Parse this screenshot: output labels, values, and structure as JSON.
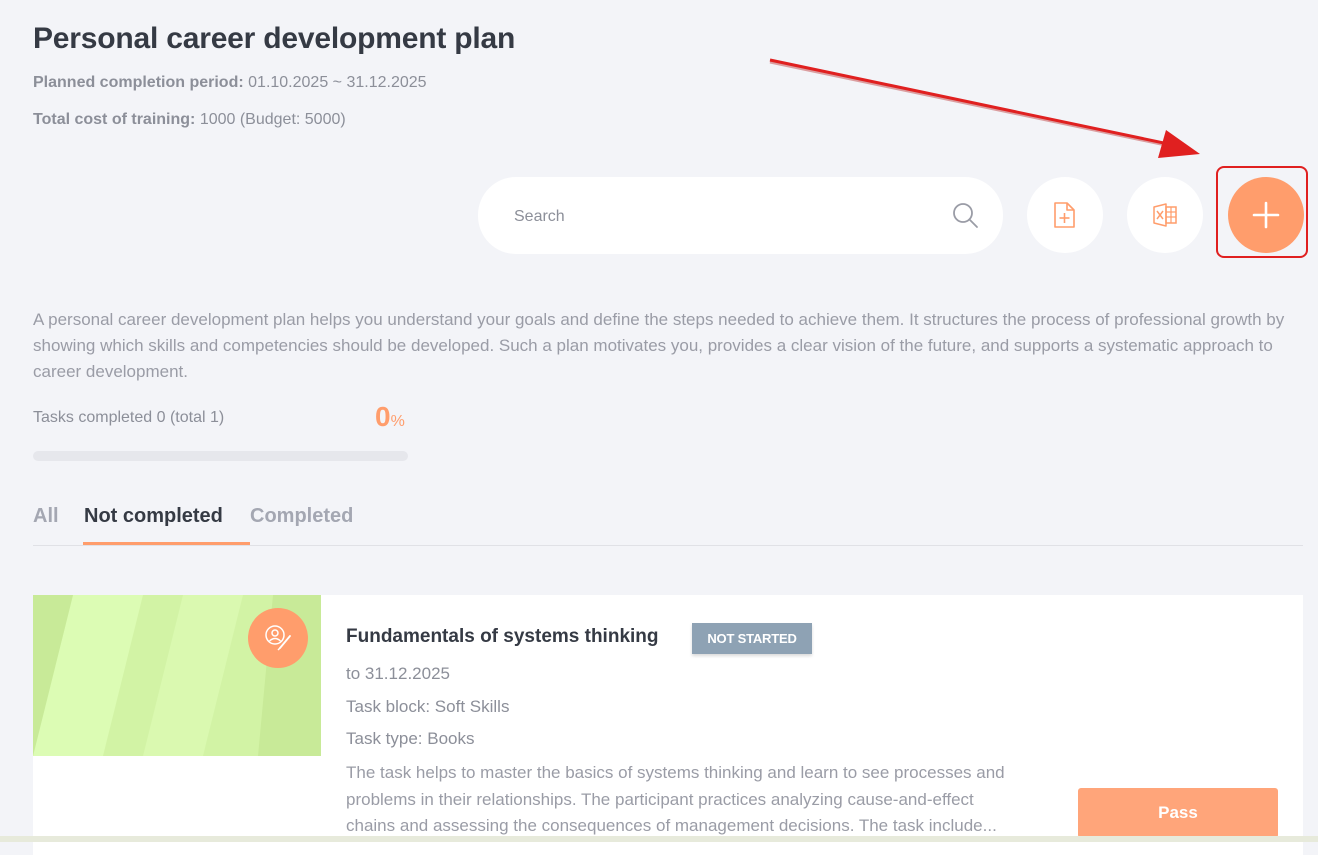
{
  "page": {
    "title": "Personal career development plan",
    "period_label": "Planned completion period:",
    "period_value": "01.10.2025 ~ 31.12.2025",
    "cost_label": "Total cost of training:",
    "cost_value": "1000 (Budget: 5000)"
  },
  "toolbar": {
    "search_placeholder": "Search",
    "icons": [
      "search-icon",
      "add-document-icon",
      "excel-export-icon",
      "plus-icon"
    ]
  },
  "description": "A personal career development plan helps you understand your goals and define the steps needed to achieve them. It structures the process of professional growth by showing which skills and competencies should be developed. Such a plan motivates you, provides a clear vision of the future, and supports a systematic approach to career development.",
  "progress": {
    "tasks_text": "Tasks completed 0 (total 1)",
    "percent_value": "0",
    "percent_sign": "%",
    "fraction": 0
  },
  "tabs": [
    {
      "label": "All",
      "active": false
    },
    {
      "label": "Not completed",
      "active": true
    },
    {
      "label": "Completed",
      "active": false
    }
  ],
  "task": {
    "title": "Fundamentals of systems thinking",
    "status": "NOT STARTED",
    "due": "to 31.12.2025",
    "block": "Task block: Soft Skills",
    "type": "Task type: Books",
    "description": "The task helps to master the basics of systems thinking and learn to see processes and problems in their relationships. The participant practices analyzing cause-and-effect chains and assessing the consequences of management decisions. The task include...",
    "action_label": "Pass"
  },
  "colors": {
    "accent": "#ff9d6c",
    "status_badge": "#8ea2b4",
    "annotation": "#e02020",
    "background": "#f3f4f8"
  }
}
